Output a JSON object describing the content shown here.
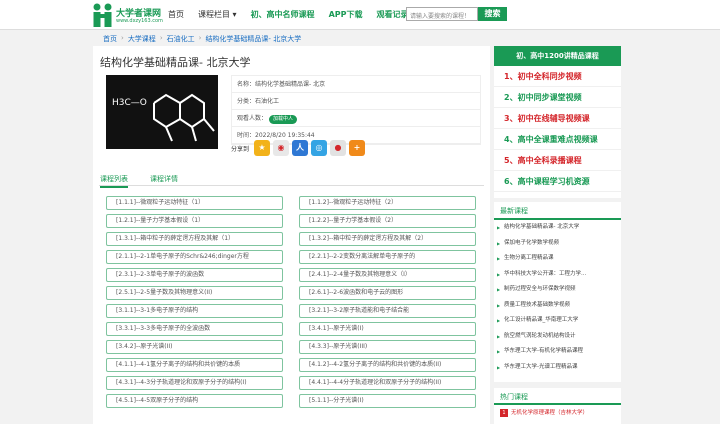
{
  "brand": {
    "name": "大学者课网",
    "url": "www.dxzy163.com"
  },
  "nav": {
    "items": [
      "首页",
      "课程栏目 ▾",
      "初、高中名师课程",
      "APP下载",
      "观看记录"
    ]
  },
  "search": {
    "placeholder": "请输入要搜索的课程！",
    "button": "搜索"
  },
  "breadcrumb": [
    "首页",
    "大学课程",
    "石油化工",
    "结构化学基础精品课- 北京大学"
  ],
  "course": {
    "title": "结构化学基础精品课- 北京大学",
    "name": "名称：结构化学基础精品课- 北京",
    "category": "分类：石油化工",
    "viewers_label": "观看人数：",
    "viewers_badge": "加载中人",
    "time": "时间：2022/8/20 19:35:44",
    "share_label": "分享到"
  },
  "thumb": {
    "formula": "H3C—O"
  },
  "tabs": [
    "课程列表",
    "课程详情"
  ],
  "lessons": [
    "[1.1.1]--微观粒子运动特征（1）",
    "[1.1.2]--微观粒子运动特征（2）",
    "[1.2.1]--量子力学基本假设（1）",
    "[1.2.2]--量子力学基本假设（2）",
    "[1.3.1]--箱中粒子的薛定谔方程及其解（1）",
    "[1.3.2]--箱中粒子的薛定谔方程及其解（2）",
    "[2.1.1]--2-1单电子原子的Schr&246;dinger方程",
    "[2.2.1]--2-2变数分离法解单电子原子的",
    "[2.3.1]--2-3单电子原子的波函数",
    "[2.4.1]--2-4量子数及其物理意义（I）",
    "[2.5.1]--2-5量子数及其物理意义(II)",
    "[2.6.1]--2-6波函数和电子云的图形",
    "[3.1.1]--3-1多电子原子的结构",
    "[3.2.1]--3-2原子轨道能和电子结合能",
    "[3.3.1]--3-3多电子原子的全波函数",
    "[3.4.1]--原子光谱(I)",
    "[3.4.2]--原子光谱(II)",
    "[4.3.3]--原子光谱(III)",
    "[4.1.1]--4-1氢分子离子的结构和共价键的本质",
    "[4.1.2]--4-2氢分子离子的结构和共价键的本质(II)",
    "[4.3.1]--4-3分子轨道理论和双原子分子的结构(I)",
    "[4.4.1]--4-4分子轨道理论和双原子分子的结构(II)",
    "[4.5.1]--4-5双原子分子的结构",
    "[5.1.1]--分子光谱(I)"
  ],
  "sidebar": {
    "title": "初、高中1200讲精品课程",
    "items": [
      "1、初中全科同步视频",
      "2、初中同步课堂视频",
      "3、初中在线辅导视频课",
      "4、高中全课重难点视频课",
      "5、高中全科录播课程",
      "6、高中课程学习机资源"
    ]
  },
  "latest": {
    "title": "最新课程",
    "items": [
      "结构化学基础精品课- 北京大学",
      "保加电子化学数学视频",
      "生物分离工程精品课",
      "华中科技大学公开课：工程力学...",
      "制药过程安全与环保数学视频",
      "质量工程技术基础数学视频",
      "化工设计精品课_华南理工大学",
      "航空燃气涡轮发动机结构设计",
      "华东理工大学-有机化学精品课程",
      "华东理工大学-光谱工程精品课"
    ]
  },
  "hot": {
    "title": "热门课程",
    "items": [
      {
        "num": "1",
        "label": "无机化学原理课程（吉林大学）"
      }
    ]
  }
}
